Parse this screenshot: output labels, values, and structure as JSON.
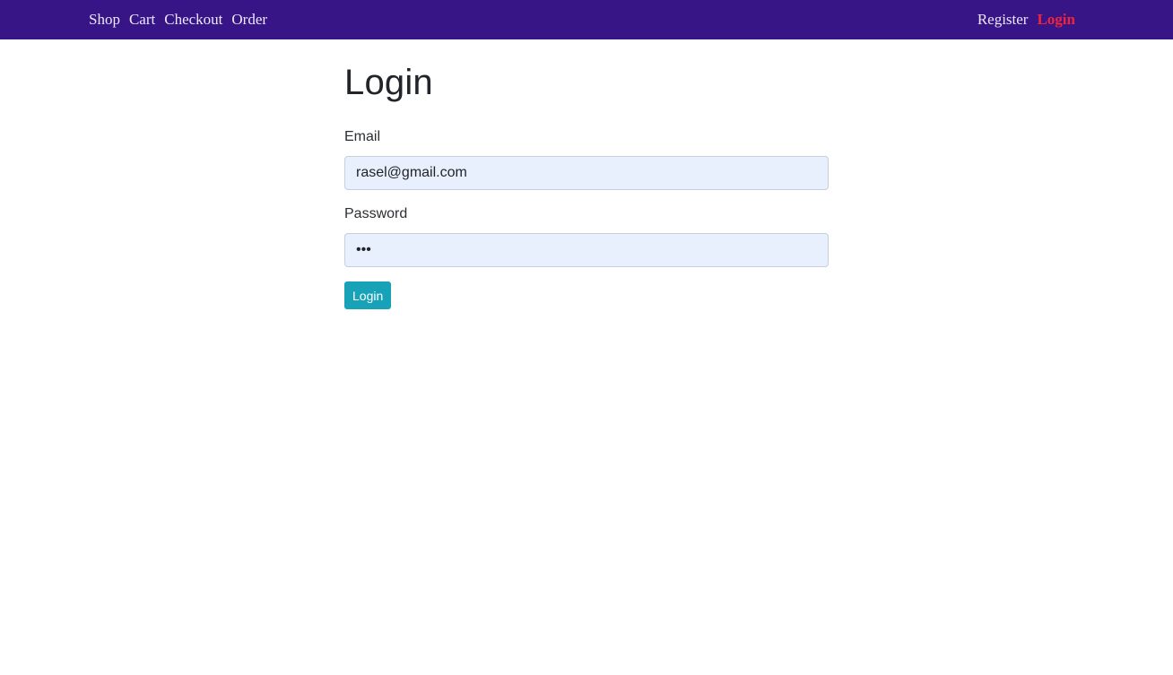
{
  "nav": {
    "left_items": [
      {
        "label": "Shop"
      },
      {
        "label": "Cart"
      },
      {
        "label": "Checkout"
      },
      {
        "label": "Order"
      }
    ],
    "right_items": [
      {
        "label": "Register"
      },
      {
        "label": "Login"
      }
    ]
  },
  "form": {
    "title": "Login",
    "email_label": "Email",
    "email_value": "rasel@gmail.com",
    "password_label": "Password",
    "password_value": "abc",
    "submit_label": "Login"
  },
  "colors": {
    "navbar_bg": "#381587",
    "active_link": "#f0243c",
    "button_bg": "#17a2b8",
    "input_bg": "#e8f0fe"
  }
}
